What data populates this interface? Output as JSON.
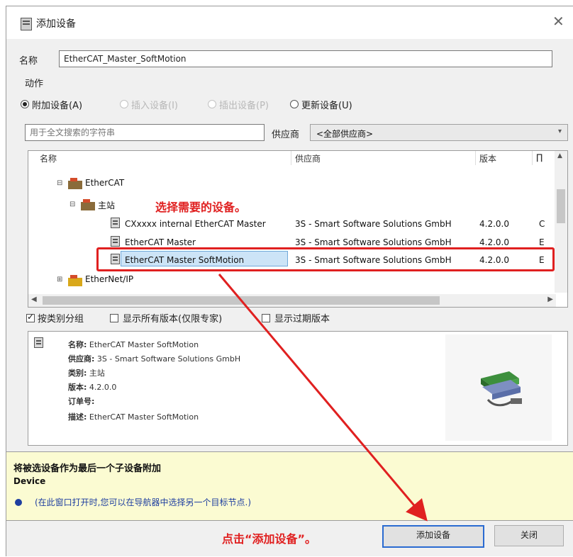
{
  "dialog": {
    "title": "添加设备"
  },
  "name_field": {
    "label": "名称",
    "value": "EtherCAT_Master_SoftMotion"
  },
  "action": {
    "label": "动作",
    "options": [
      {
        "label": "附加设备(A)",
        "selected": true,
        "enabled": true
      },
      {
        "label": "插入设备(I)",
        "selected": false,
        "enabled": false
      },
      {
        "label": "插出设备(P)",
        "selected": false,
        "enabled": false
      },
      {
        "label": "更新设备(U)",
        "selected": false,
        "enabled": true
      }
    ]
  },
  "search": {
    "placeholder": "用于全文搜索的字符串"
  },
  "vendor": {
    "label": "供应商",
    "value": "<全部供应商>"
  },
  "tree": {
    "columns": [
      "名称",
      "供应商",
      "版本",
      "∏"
    ],
    "rows": [
      {
        "name": "EtherCAT",
        "level": 1
      },
      {
        "name": "主站",
        "level": 2
      },
      {
        "name": "CXxxxx internal EtherCAT Master",
        "vendor": "3S - Smart Software Solutions GmbH",
        "version": "4.2.0.0",
        "extra": "C",
        "level": 3
      },
      {
        "name": "EtherCAT Master",
        "vendor": "3S - Smart Software Solutions GmbH",
        "version": "4.2.0.0",
        "extra": "E",
        "level": 3
      },
      {
        "name": "EtherCAT Master SoftMotion",
        "vendor": "3S - Smart Software Solutions GmbH",
        "version": "4.2.0.0",
        "extra": "E",
        "level": 3,
        "selected": true
      },
      {
        "name": "EtherNet/IP",
        "level": 1
      }
    ]
  },
  "options": {
    "group_by_category": "按类别分组",
    "show_all_versions": "显示所有版本(仅限专家)",
    "show_expired": "显示过期版本"
  },
  "details": {
    "name_key": "名称:",
    "name_val": "EtherCAT Master SoftMotion",
    "vendor_key": "供应商:",
    "vendor_val": "3S - Smart Software Solutions GmbH",
    "category_key": "类别:",
    "category_val": "主站",
    "version_key": "版本:",
    "version_val": "4.2.0.0",
    "order_key": "订单号:",
    "desc_key": "描述:",
    "desc_val": "EtherCAT Master SoftMotion"
  },
  "note": {
    "title": "将被选设备作为最后一个子设备附加",
    "subtitle": "Device",
    "hint": "(在此窗口打开时,您可以在导航器中选择另一个目标节点.)"
  },
  "buttons": {
    "add": "添加设备",
    "close": "关闭"
  },
  "annotations": {
    "select_device": "选择需要的设备。",
    "click_add": "点击“添加设备”。"
  },
  "colors": {
    "annotation_red": "#e02020",
    "selection": "#cce4f7",
    "note_bg": "#fbfbd2"
  }
}
